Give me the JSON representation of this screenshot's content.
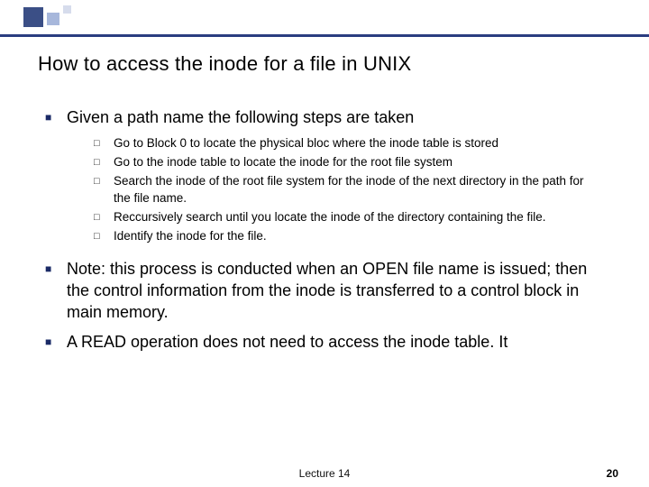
{
  "title": "How to access the inode for a file in UNIX",
  "points": {
    "p1": "Given a path name the following steps are taken",
    "sub": {
      "s1": "Go to Block 0 to locate the physical bloc where the inode table is stored",
      "s2": "Go to the inode table to locate the inode for the root file system",
      "s3": "Search the inode of the root file system for the inode of the next directory in the path for the file name.",
      "s4": "Reccursively search until you locate the inode of the directory containing the file.",
      "s5": "Identify the inode for the file."
    },
    "p2": "Note: this process  is conducted  when an OPEN file name is issued; then the control information  from the inode is transferred  to a control block in main memory.",
    "p3": "A READ operation does not need to access the inode table. It"
  },
  "footer": {
    "lecture": "Lecture 14",
    "page": "20"
  }
}
